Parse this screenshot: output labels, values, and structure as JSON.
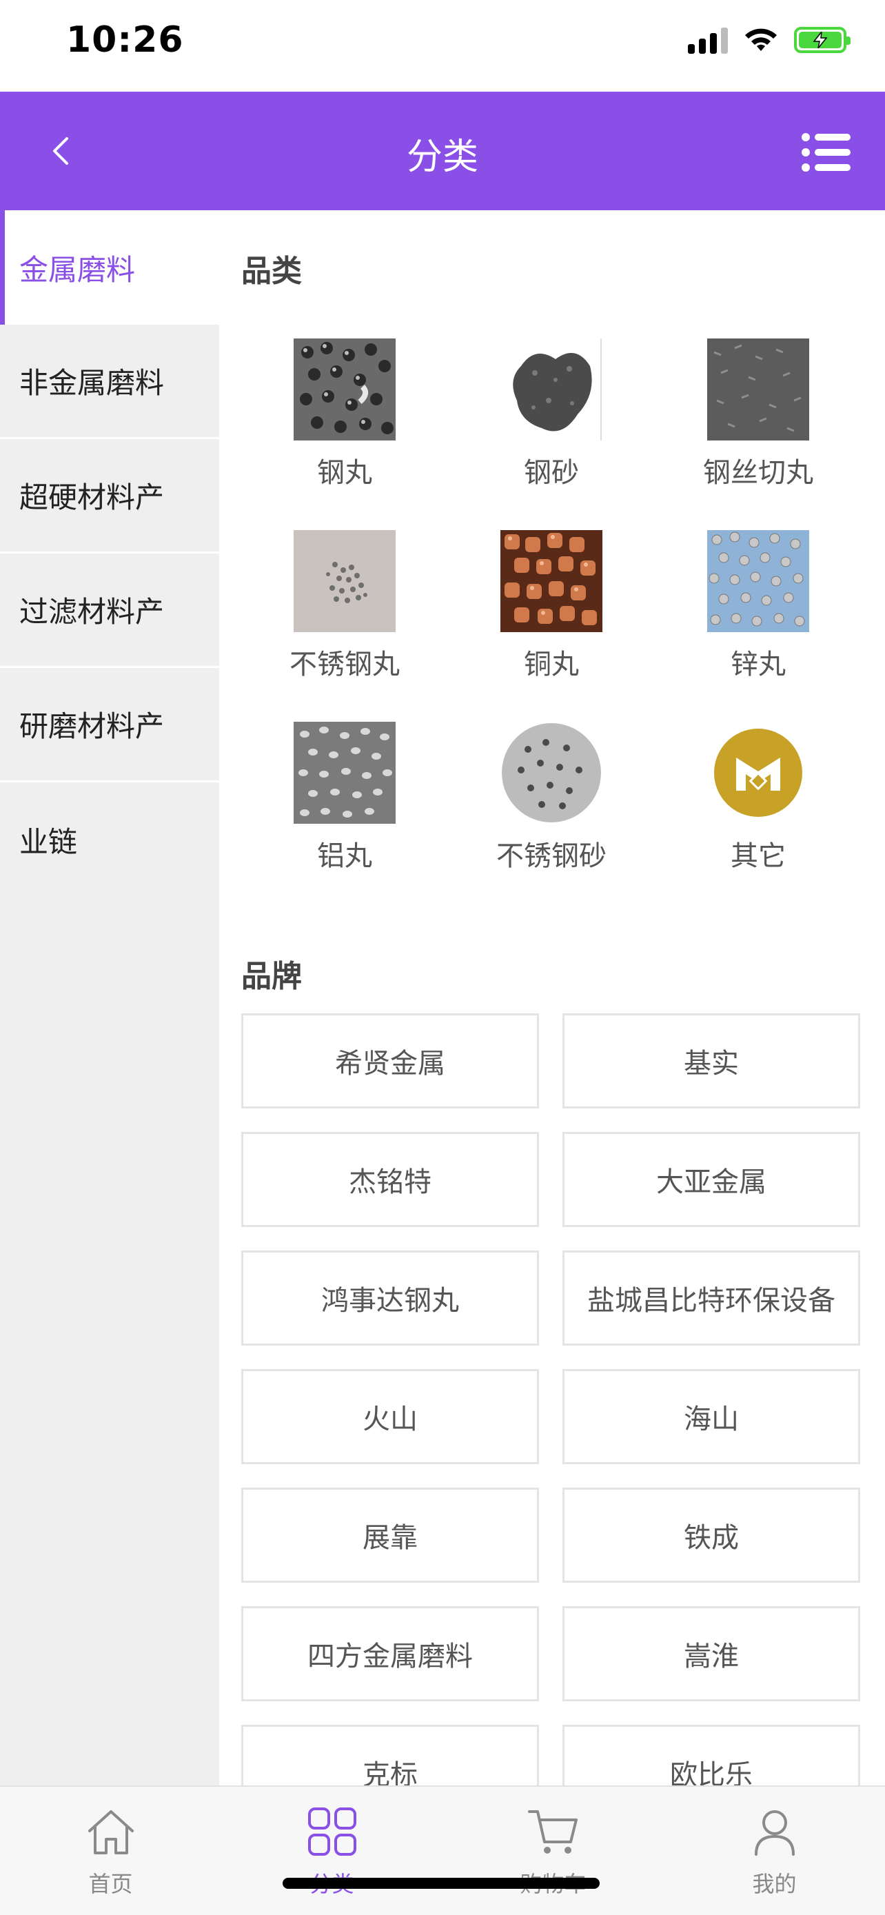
{
  "status_bar": {
    "time": "10:26"
  },
  "header": {
    "title": "分类",
    "back_icon": "chevron-left-icon",
    "menu_icon": "list-menu-icon"
  },
  "sidebar": {
    "items": [
      {
        "label": "金属磨料",
        "active": true
      },
      {
        "label": "非金属磨料",
        "active": false
      },
      {
        "label": "超硬材料产",
        "active": false
      },
      {
        "label": "过滤材料产",
        "active": false
      },
      {
        "label": "研磨材料产",
        "active": false
      },
      {
        "label": "业链",
        "active": false
      }
    ]
  },
  "categories": {
    "title": "品类",
    "items": [
      {
        "label": "钢丸"
      },
      {
        "label": "钢砂"
      },
      {
        "label": "钢丝切丸"
      },
      {
        "label": "不锈钢丸"
      },
      {
        "label": "铜丸"
      },
      {
        "label": "锌丸"
      },
      {
        "label": "铝丸"
      },
      {
        "label": "不锈钢砂"
      },
      {
        "label": "其它"
      }
    ]
  },
  "brands": {
    "title": "品牌",
    "items": [
      "希贤金属",
      "基实",
      "杰铭特",
      "大亚金属",
      "鸿事达钢丸",
      "盐城昌比特环保设备",
      "火山",
      "海山",
      "展靠",
      "铁成",
      "四方金属磨料",
      "嵩淮",
      "克标",
      "欧比乐"
    ]
  },
  "tab_bar": {
    "items": [
      {
        "label": "首页",
        "icon": "home-icon",
        "active": false
      },
      {
        "label": "分类",
        "icon": "grid-icon",
        "active": true
      },
      {
        "label": "购物车",
        "icon": "cart-icon",
        "active": false
      },
      {
        "label": "我的",
        "icon": "user-icon",
        "active": false
      }
    ]
  },
  "colors": {
    "accent": "#8a4fe6",
    "battery": "#4ad83e"
  }
}
